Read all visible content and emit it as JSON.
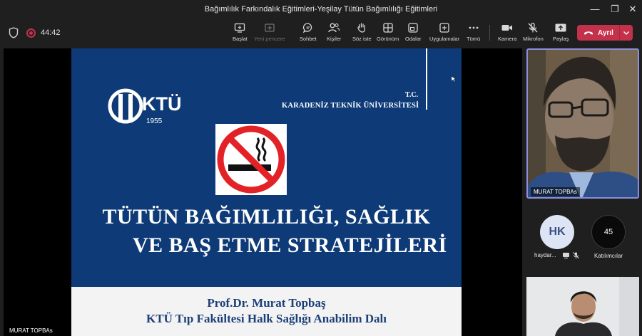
{
  "window": {
    "title": "Bağımlılık Farkındalık Eğitimleri-Yeşilay Tütün Bağımlılığı Eğitimleri",
    "controls": {
      "minimize": "—",
      "maximize": "❐",
      "close": "✕"
    }
  },
  "toolbar": {
    "timer": "44:42",
    "tools": [
      {
        "label": "Başlat",
        "icon": "start-share-icon"
      },
      {
        "label": "Yeni pencere",
        "icon": "new-window-icon",
        "disabled": true
      },
      {
        "label": "Sohbet",
        "icon": "chat-icon"
      },
      {
        "label": "Kişiler",
        "icon": "people-icon"
      },
      {
        "label": "Söz iste",
        "icon": "raise-hand-icon"
      },
      {
        "label": "Görünüm",
        "icon": "view-icon"
      },
      {
        "label": "Odalar",
        "icon": "rooms-icon"
      },
      {
        "label": "Uygulamalar",
        "icon": "apps-icon"
      },
      {
        "label": "Tümü",
        "icon": "more-icon"
      },
      {
        "label": "Kamera",
        "icon": "camera-icon"
      },
      {
        "label": "Mikrofon",
        "icon": "mic-off-icon"
      },
      {
        "label": "Paylaş",
        "icon": "share-icon"
      }
    ],
    "leave_label": "Ayrıl",
    "colors": {
      "leave": "#c4314b",
      "background": "#1f1f1f"
    }
  },
  "slide": {
    "logo_text": "KTÜ",
    "logo_year": "1955",
    "tc": "T.C.",
    "university": "KARADENİZ TEKNİK ÜNİVERSİTESİ",
    "title_line1": "TÜTÜN BAĞIMLILIĞI, SAĞLIK",
    "title_line2": "VE BAŞ ETME STRATEJİLERİ",
    "author": "Prof.Dr. Murat Topbaş",
    "department": "KTÜ Tıp Fakültesi Halk Sağlığı Anabilim Dalı",
    "colors": {
      "blue": "#0e3b77",
      "white_band": "#f3f3f4",
      "text_blue": "#1b3f77",
      "no_sign_red": "#e32227"
    }
  },
  "presenter_label": "MURAT TOPBAs",
  "participants": {
    "main_video_name": "MURAT TOPBAs",
    "hk": {
      "initials": "HK",
      "name": "haydar..."
    },
    "count": "45",
    "count_label": "Katılımcılar"
  }
}
